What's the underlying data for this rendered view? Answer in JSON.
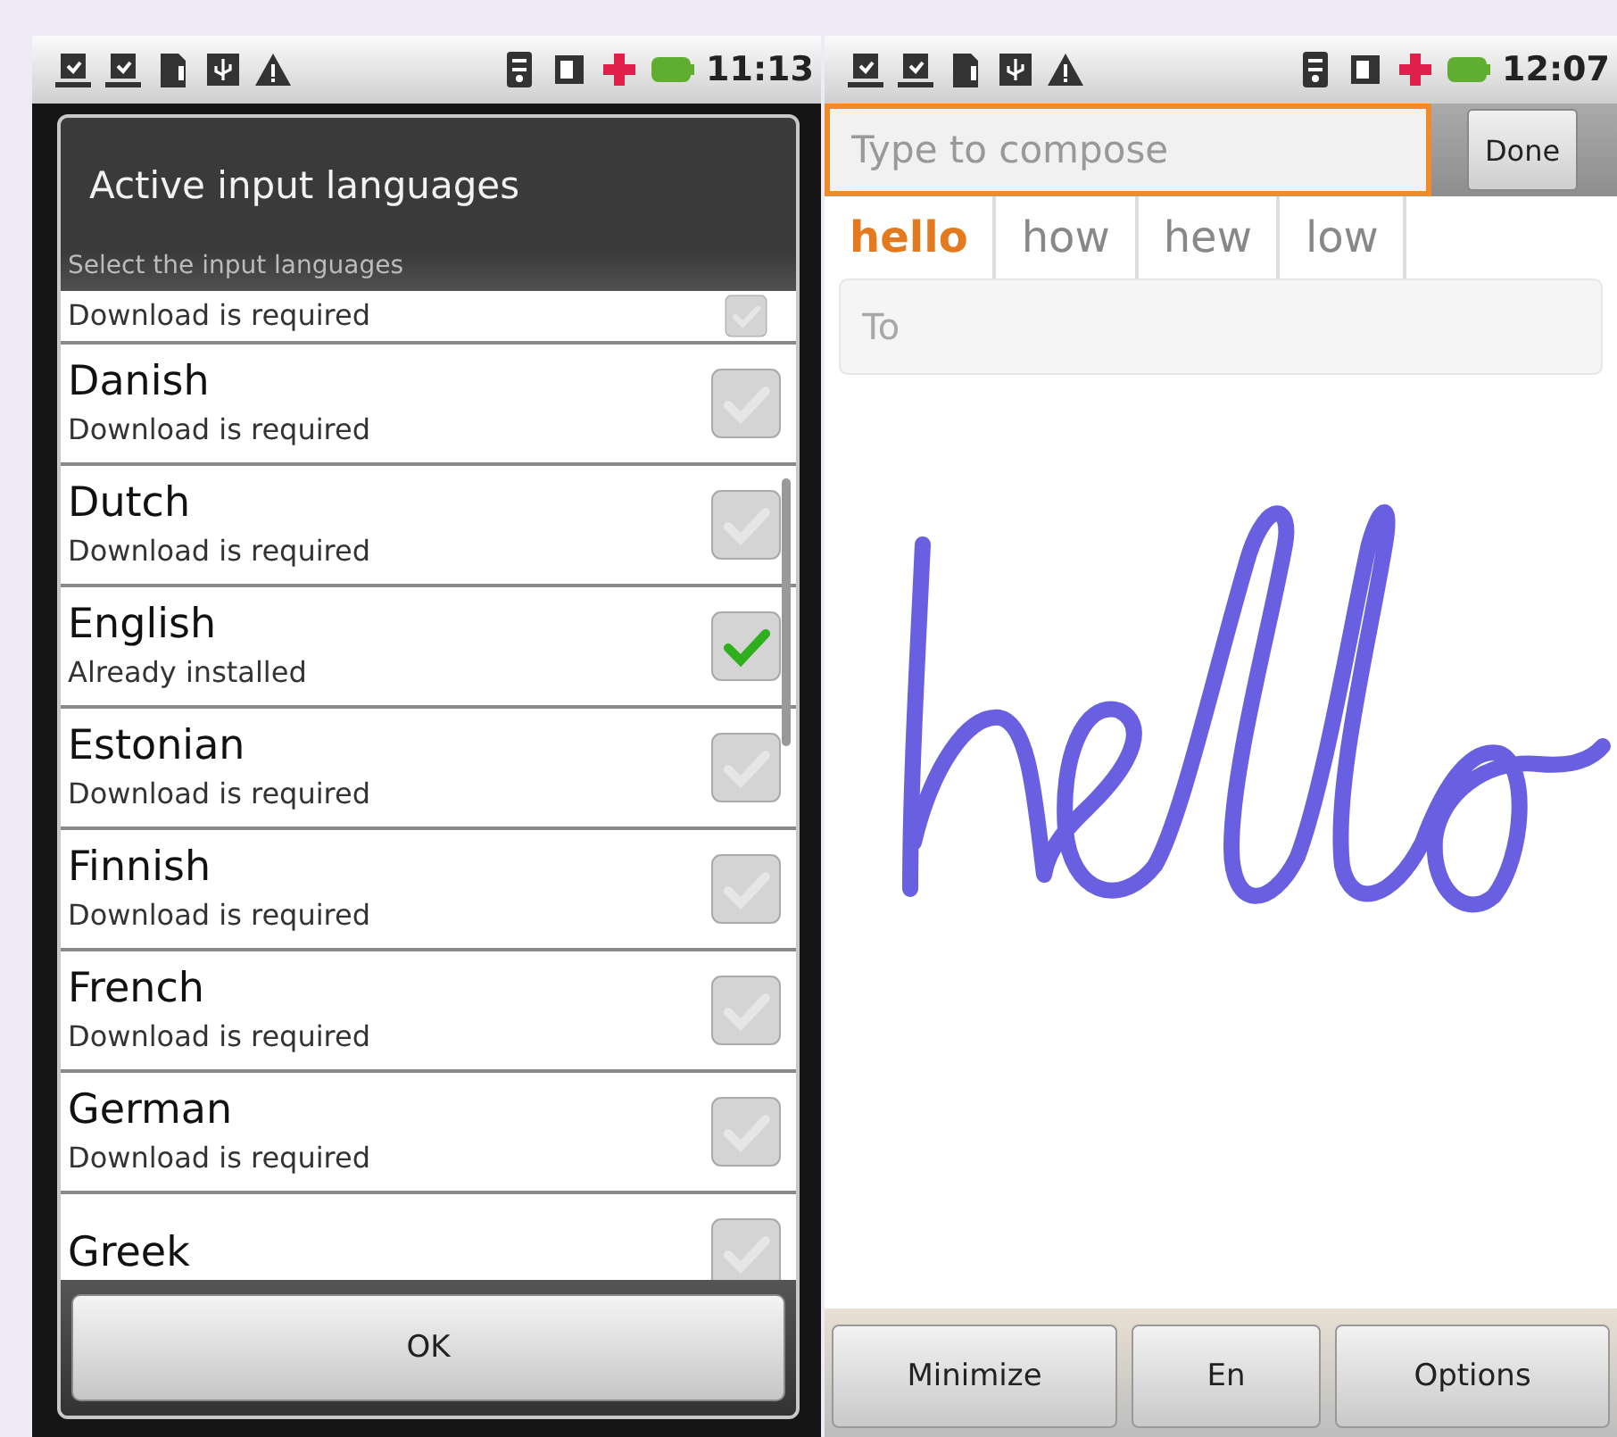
{
  "left_screen": {
    "status_bar": {
      "time": "11:13"
    },
    "dialog": {
      "title": "Active input languages",
      "category": "Select the input languages",
      "languages": [
        {
          "subtitle": "Download is required",
          "checked": false
        },
        {
          "name": "Danish",
          "subtitle": "Download is required",
          "checked": false
        },
        {
          "name": "Dutch",
          "subtitle": "Download is required",
          "checked": false
        },
        {
          "name": "English",
          "subtitle": "Already installed",
          "checked": true
        },
        {
          "name": "Estonian",
          "subtitle": "Download is required",
          "checked": false
        },
        {
          "name": "Finnish",
          "subtitle": "Download is required",
          "checked": false
        },
        {
          "name": "French",
          "subtitle": "Download is required",
          "checked": false
        },
        {
          "name": "German",
          "subtitle": "Download is required",
          "checked": false
        },
        {
          "name": "Greek",
          "checked": false
        }
      ],
      "ok_button": "OK"
    }
  },
  "right_screen": {
    "status_bar": {
      "time": "12:07"
    },
    "compose": {
      "placeholder": "Type to compose",
      "done_button": "Done"
    },
    "suggestions": [
      {
        "word": "hello",
        "selected": true
      },
      {
        "word": "how",
        "selected": false
      },
      {
        "word": "hew",
        "selected": false
      },
      {
        "word": "low",
        "selected": false
      }
    ],
    "to_field": {
      "placeholder": "To"
    },
    "buttons": [
      "Minimize",
      "En",
      "Options"
    ]
  }
}
